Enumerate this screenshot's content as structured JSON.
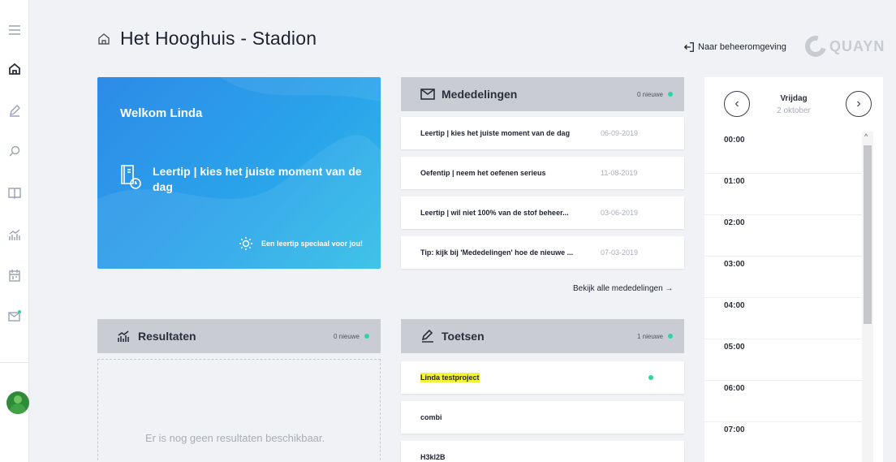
{
  "header": {
    "title": "Het Hooghuis - Stadion",
    "beheer_link": "Naar beheeromgeving",
    "logo_text": "QUAYN"
  },
  "sidebar": {
    "items": [
      {
        "icon": "menu-icon"
      },
      {
        "icon": "home-icon",
        "active": true
      },
      {
        "icon": "pen-icon"
      },
      {
        "icon": "search-icon"
      },
      {
        "icon": "book-icon"
      },
      {
        "icon": "chart-icon"
      },
      {
        "icon": "calendar-icon"
      },
      {
        "icon": "mail-icon",
        "badge": true
      }
    ]
  },
  "welcome": {
    "greeting": "Welkom Linda",
    "tip": "Leertip | kies het juiste moment van de dag",
    "footer": "Een leertip speciaal voor jou!"
  },
  "mededelingen": {
    "title": "Mededelingen",
    "new_count": "0 nieuwe",
    "items": [
      {
        "title": "Leertip | kies het juiste moment van de dag",
        "date": "06-09-2019"
      },
      {
        "title": "Oefentip | neem het oefenen serieus",
        "date": "11-08-2019"
      },
      {
        "title": "Leertip | wil niet 100% van de stof beheer...",
        "date": "03-06-2019"
      },
      {
        "title": "Tip: kijk bij 'Mededelingen' hoe de nieuwe ...",
        "date": "07-03-2019"
      }
    ],
    "all_link": "Bekijk alle mededelingen →"
  },
  "resultaten": {
    "title": "Resultaten",
    "new_count": "0 nieuwe",
    "empty_message": "Er is nog geen resultaten beschikbaar."
  },
  "toetsen": {
    "title": "Toetsen",
    "new_count": "1 nieuwe",
    "items": [
      {
        "title": "Linda testproject",
        "highlighted": true,
        "new": true
      },
      {
        "title": "combi"
      },
      {
        "title": "H3kl2B"
      }
    ]
  },
  "calendar": {
    "day": "Vrijdag",
    "date": "2 oktober",
    "hours": [
      "00:00",
      "01:00",
      "02:00",
      "03:00",
      "04:00",
      "05:00",
      "06:00",
      "07:00"
    ]
  },
  "colors": {
    "accent_blue": "#2d8be8",
    "new_dot": "#2fd5a0",
    "panel_head": "#c9ccd3",
    "highlight": "#f5f23a"
  }
}
